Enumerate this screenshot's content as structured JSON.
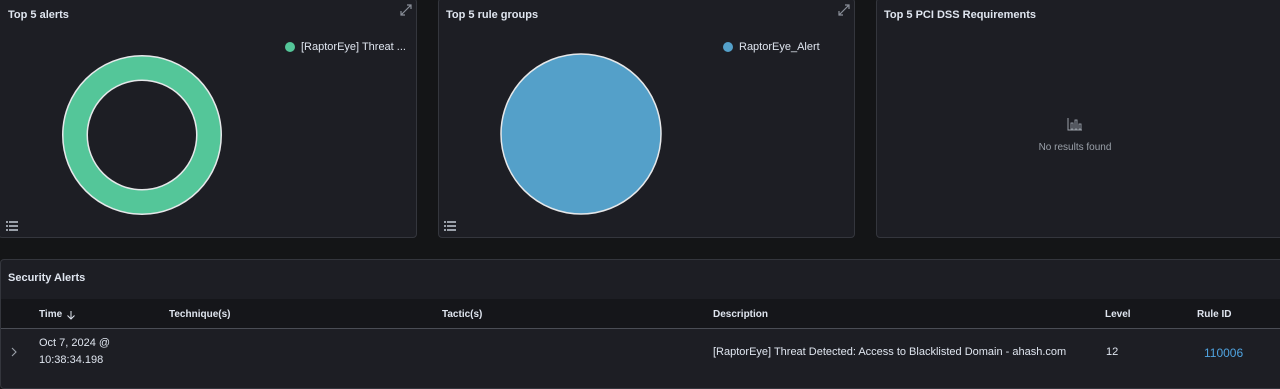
{
  "panels": {
    "top_alerts": {
      "title": "Top 5 alerts",
      "legend": [
        {
          "label": "[RaptorEye] Threat ...",
          "color": "#54c699"
        }
      ]
    },
    "top_rule_groups": {
      "title": "Top 5 rule groups",
      "legend": [
        {
          "label": "RaptorEye_Alert",
          "color": "#54a0c9"
        }
      ]
    },
    "top_pci": {
      "title": "Top 5 PCI DSS Requirements",
      "empty_text": "No results found"
    }
  },
  "security_alerts": {
    "title": "Security Alerts",
    "columns": [
      "Time",
      "Technique(s)",
      "Tactic(s)",
      "Description",
      "Level",
      "Rule ID"
    ],
    "rows": [
      {
        "time_line1": "Oct 7, 2024 @",
        "time_line2": "10:38:34.198",
        "technique": "",
        "tactic": "",
        "description": "[RaptorEye] Threat Detected: Access to Blacklisted Domain - ahash.com",
        "level": "12",
        "rule_id": "110006"
      }
    ]
  },
  "icons": [
    "expand-icon",
    "list-icon",
    "chart-empty-icon",
    "sort-down-icon",
    "chevron-right-icon"
  ]
}
